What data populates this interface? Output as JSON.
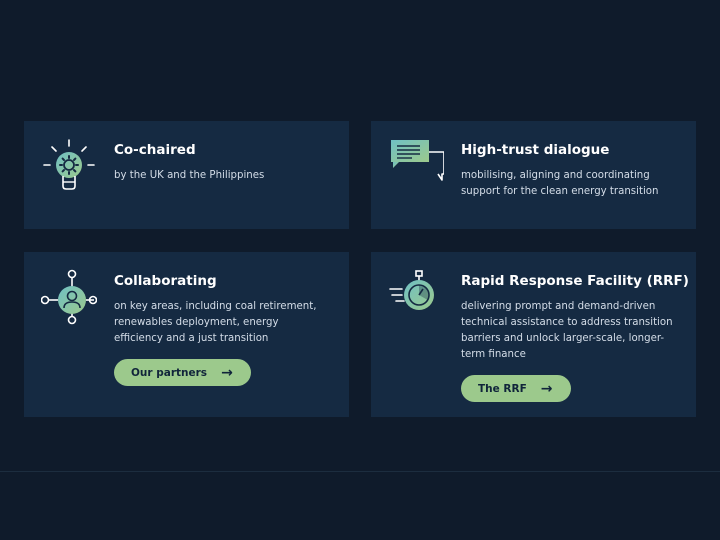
{
  "cards": [
    {
      "icon": "lightbulb-gear-icon",
      "title": "Co-chaired",
      "desc_lines": [
        "by the UK and the Philippines"
      ]
    },
    {
      "icon": "chat-bubble-icon",
      "title": "High-trust dialogue",
      "desc_lines": [
        "mobilising, aligning and coordinating",
        "support for the clean energy transition"
      ]
    },
    {
      "icon": "network-person-icon",
      "title": "Collaborating",
      "desc_lines": [
        "on key areas, including coal retirement,",
        "renewables deployment, energy",
        "efficiency and a just transition"
      ],
      "button": {
        "label": "Our partners",
        "arrow": "→"
      }
    },
    {
      "icon": "stopwatch-icon",
      "title": "Rapid Response Facility (RRF)",
      "desc_lines": [
        "delivering prompt and demand-driven",
        "technical assistance to address transition",
        "barriers and unlock larger-scale, longer-",
        "term finance"
      ],
      "button": {
        "label": "The RRF",
        "arrow": "→"
      }
    }
  ],
  "colors": {
    "background": "#0f1b2b",
    "card": "#152a42",
    "button": "#9cc98c",
    "icon_teal": "#6fc0c4",
    "icon_green": "#9cc98c"
  }
}
